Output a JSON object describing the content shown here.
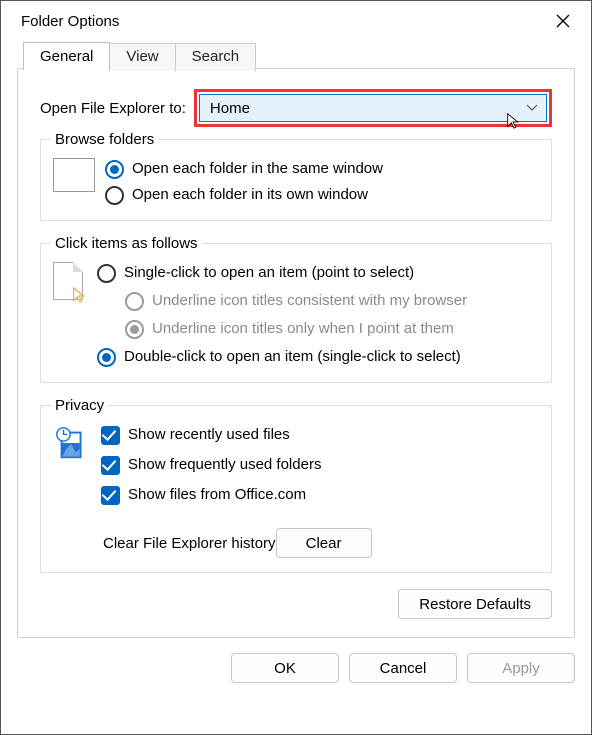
{
  "title": "Folder Options",
  "tabs": {
    "general": "General",
    "view": "View",
    "search": "Search"
  },
  "openTo": {
    "label": "Open File Explorer to:",
    "value": "Home"
  },
  "browse": {
    "legend": "Browse folders",
    "sameWindow": "Open each folder in the same window",
    "ownWindow": "Open each folder in its own window"
  },
  "click": {
    "legend": "Click items as follows",
    "single": "Single-click to open an item (point to select)",
    "underlineBrowser": "Underline icon titles consistent with my browser",
    "underlinePoint": "Underline icon titles only when I point at them",
    "double": "Double-click to open an item (single-click to select)"
  },
  "privacy": {
    "legend": "Privacy",
    "recent": "Show recently used files",
    "frequent": "Show frequently used folders",
    "office": "Show files from Office.com",
    "clearLabel": "Clear File Explorer history",
    "clearBtn": "Clear"
  },
  "restore": "Restore Defaults",
  "buttons": {
    "ok": "OK",
    "cancel": "Cancel",
    "apply": "Apply"
  }
}
